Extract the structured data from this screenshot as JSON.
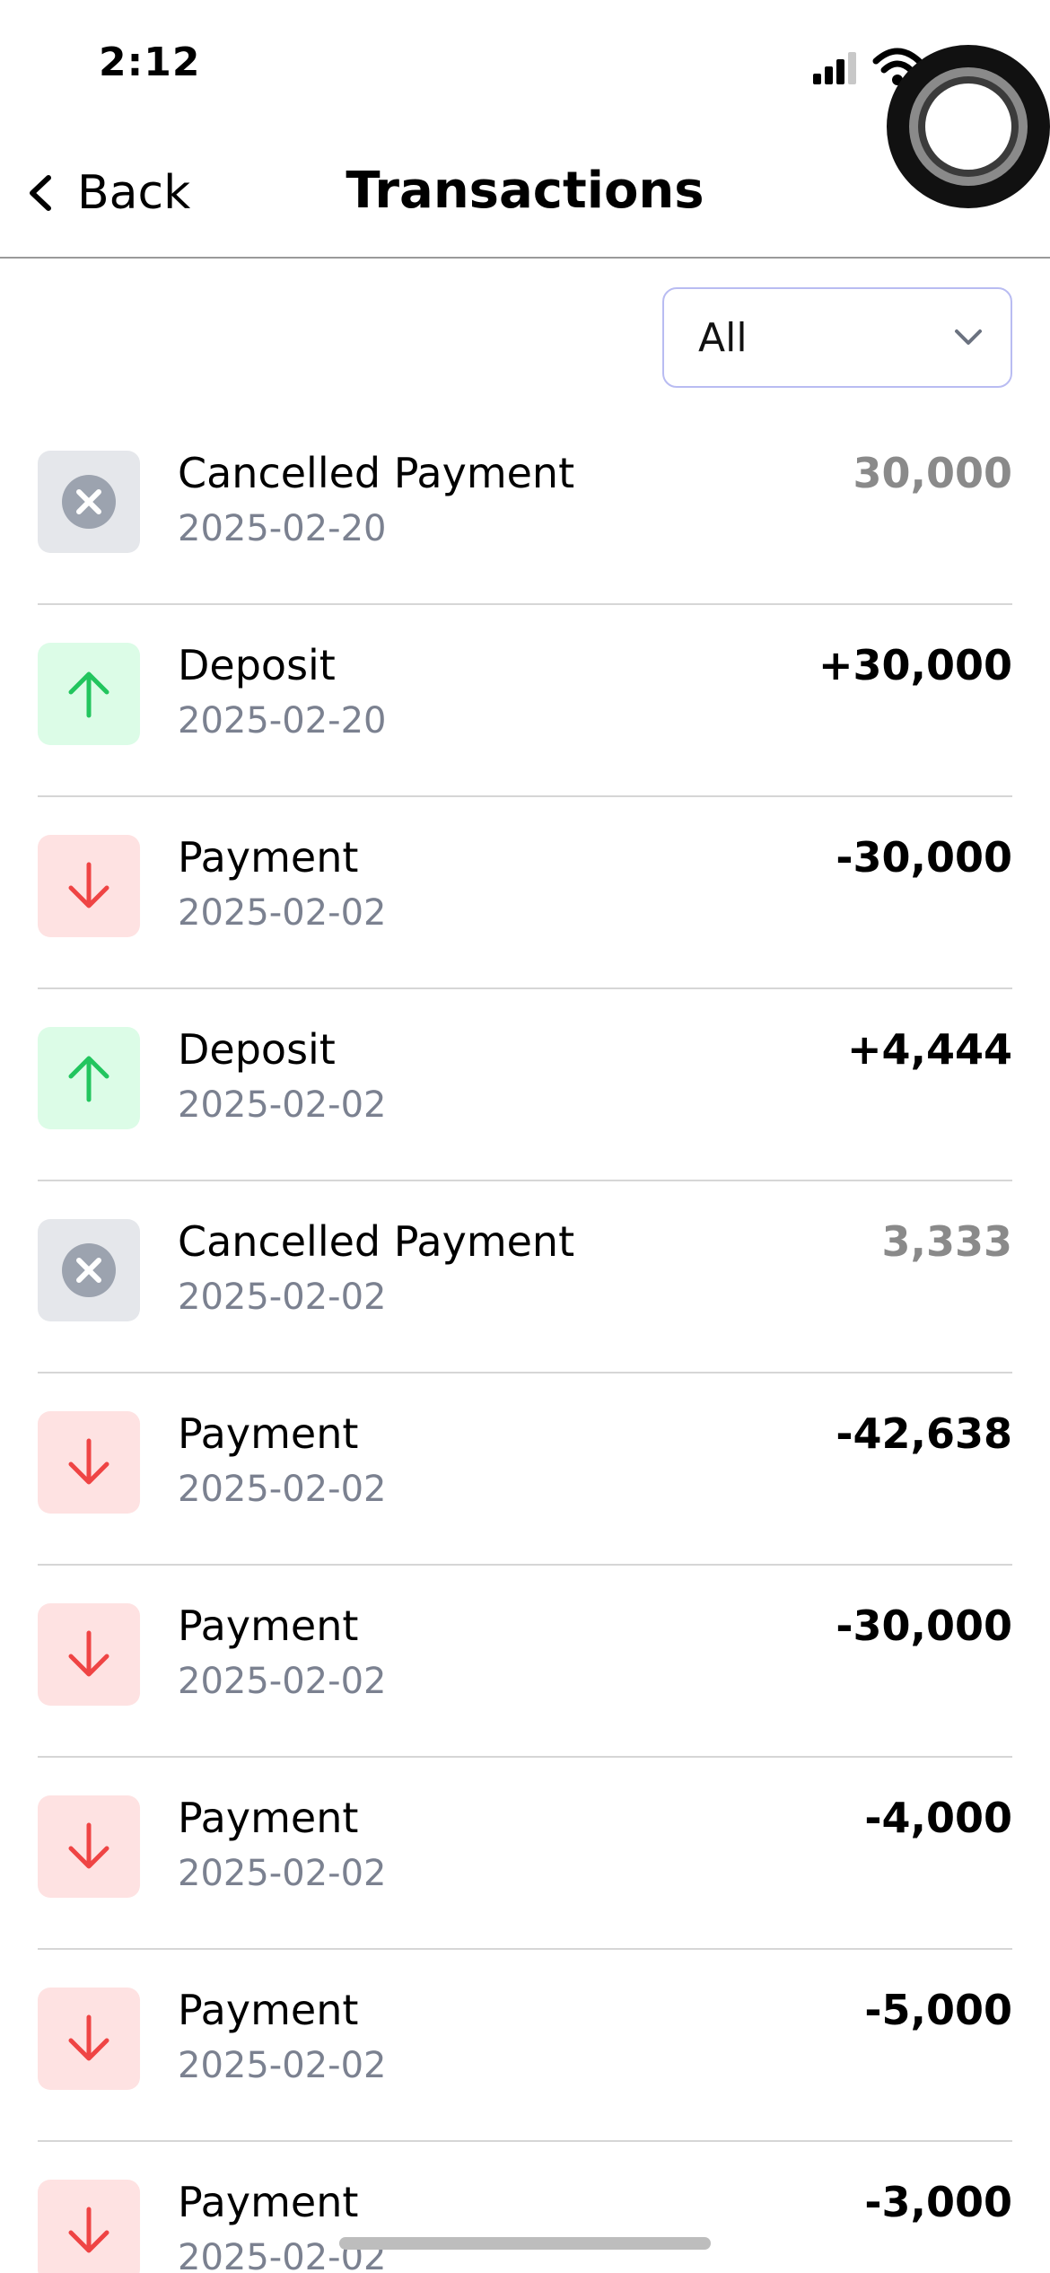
{
  "status_bar": {
    "time": "2:12"
  },
  "nav": {
    "back_label": "Back",
    "title": "Transactions"
  },
  "filter": {
    "value": "All",
    "icon": "chevron-down-icon"
  },
  "colors": {
    "cancel_bg": "#e5e7eb",
    "deposit_bg": "#dcfce7",
    "payment_bg": "#fee2e2",
    "deposit_arrow": "#22c55e",
    "payment_arrow": "#ef4444",
    "cancel_icon": "#9ca3af"
  },
  "transactions": [
    {
      "type": "cancel",
      "icon": "close-circle-icon",
      "title": "Cancelled Payment",
      "date": "2025-02-20",
      "amount": "30,000"
    },
    {
      "type": "deposit",
      "icon": "arrow-up-icon",
      "title": "Deposit",
      "date": "2025-02-20",
      "amount": "+30,000"
    },
    {
      "type": "payment",
      "icon": "arrow-down-icon",
      "title": "Payment",
      "date": "2025-02-02",
      "amount": "-30,000"
    },
    {
      "type": "deposit",
      "icon": "arrow-up-icon",
      "title": "Deposit",
      "date": "2025-02-02",
      "amount": "+4,444"
    },
    {
      "type": "cancel",
      "icon": "close-circle-icon",
      "title": "Cancelled Payment",
      "date": "2025-02-02",
      "amount": "3,333"
    },
    {
      "type": "payment",
      "icon": "arrow-down-icon",
      "title": "Payment",
      "date": "2025-02-02",
      "amount": "-42,638"
    },
    {
      "type": "payment",
      "icon": "arrow-down-icon",
      "title": "Payment",
      "date": "2025-02-02",
      "amount": "-30,000"
    },
    {
      "type": "payment",
      "icon": "arrow-down-icon",
      "title": "Payment",
      "date": "2025-02-02",
      "amount": "-4,000"
    },
    {
      "type": "payment",
      "icon": "arrow-down-icon",
      "title": "Payment",
      "date": "2025-02-02",
      "amount": "-5,000"
    },
    {
      "type": "payment",
      "icon": "arrow-down-icon",
      "title": "Payment",
      "date": "2025-02-02",
      "amount": "-3,000"
    }
  ]
}
